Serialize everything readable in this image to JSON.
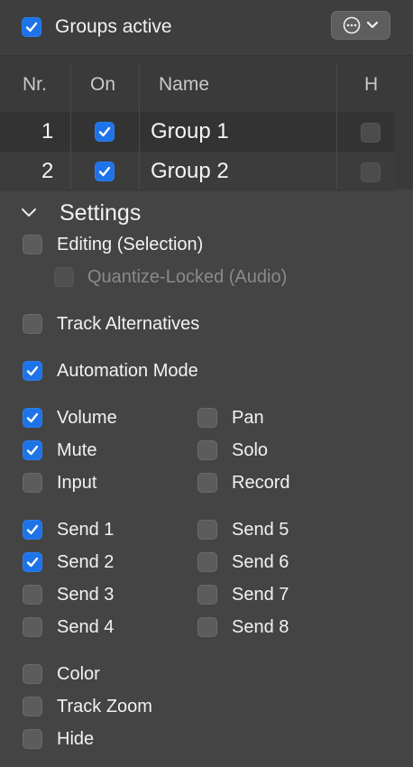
{
  "header": {
    "groups_active_label": "Groups active",
    "groups_active_checked": true
  },
  "table": {
    "columns": [
      "Nr.",
      "On",
      "Name",
      "H"
    ],
    "rows": [
      {
        "nr": "1",
        "on": true,
        "name": "Group 1",
        "h": false
      },
      {
        "nr": "2",
        "on": true,
        "name": "Group 2",
        "h": false
      }
    ]
  },
  "settings": {
    "title": "Settings",
    "editing": {
      "label": "Editing (Selection)",
      "checked": false
    },
    "quantize": {
      "label": "Quantize-Locked (Audio)",
      "checked": false,
      "disabled": true
    },
    "track_alternatives": {
      "label": "Track Alternatives",
      "checked": false
    },
    "automation_mode": {
      "label": "Automation Mode",
      "checked": true
    },
    "volume": {
      "label": "Volume",
      "checked": true
    },
    "pan": {
      "label": "Pan",
      "checked": false
    },
    "mute": {
      "label": "Mute",
      "checked": true
    },
    "solo": {
      "label": "Solo",
      "checked": false
    },
    "input": {
      "label": "Input",
      "checked": false
    },
    "record": {
      "label": "Record",
      "checked": false
    },
    "send1": {
      "label": "Send 1",
      "checked": true
    },
    "send5": {
      "label": "Send 5",
      "checked": false
    },
    "send2": {
      "label": "Send 2",
      "checked": true
    },
    "send6": {
      "label": "Send 6",
      "checked": false
    },
    "send3": {
      "label": "Send 3",
      "checked": false
    },
    "send7": {
      "label": "Send 7",
      "checked": false
    },
    "send4": {
      "label": "Send 4",
      "checked": false
    },
    "send8": {
      "label": "Send 8",
      "checked": false
    },
    "color": {
      "label": "Color",
      "checked": false
    },
    "track_zoom": {
      "label": "Track Zoom",
      "checked": false
    },
    "hide": {
      "label": "Hide",
      "checked": false
    }
  },
  "colors": {
    "background": "#444444",
    "accent": "#1e73e8"
  },
  "icons": {
    "more_menu": "ellipsis-circle-icon",
    "dropdown": "chevron-down-icon",
    "disclosure": "chevron-down-icon"
  }
}
